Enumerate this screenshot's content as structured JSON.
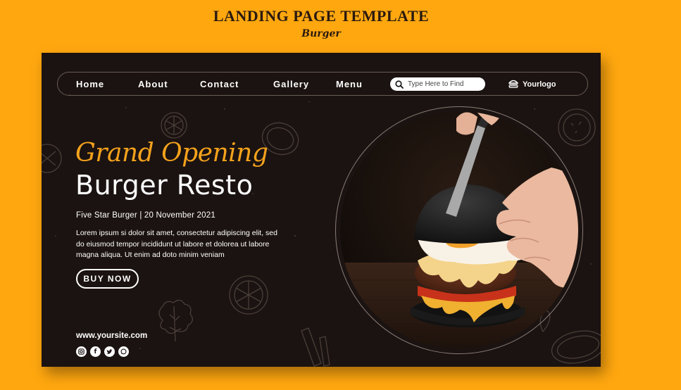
{
  "header": {
    "title": "LANDING PAGE TEMPLATE",
    "subtitle": "Burger"
  },
  "nav": {
    "links": [
      "Home",
      "About",
      "Contact",
      "Gallery",
      "Menu"
    ],
    "search_placeholder": "Type Here to Find",
    "logo_text": "Yourlogo"
  },
  "hero": {
    "script_title": "Grand Opening",
    "main_title": "Burger Resto",
    "meta": "Five Star Burger | 20 November 2021",
    "body": "Lorem ipsum si dolor sit amet, consectetur adipiscing elit, sed do eiusmod tempor incididunt ut labore et dolorea ut labore magna aliqua. Ut enim ad doto minim veniam",
    "cta_label": "BUY NOW"
  },
  "footer": {
    "url": "www.yoursite.com",
    "socials": [
      "instagram-icon",
      "facebook-icon",
      "twitter-icon",
      "whatsapp-icon"
    ]
  },
  "colors": {
    "background": "#FFA70F",
    "panel": "#1b1311",
    "accent": "#F5A21C",
    "text": "#ffffff"
  }
}
